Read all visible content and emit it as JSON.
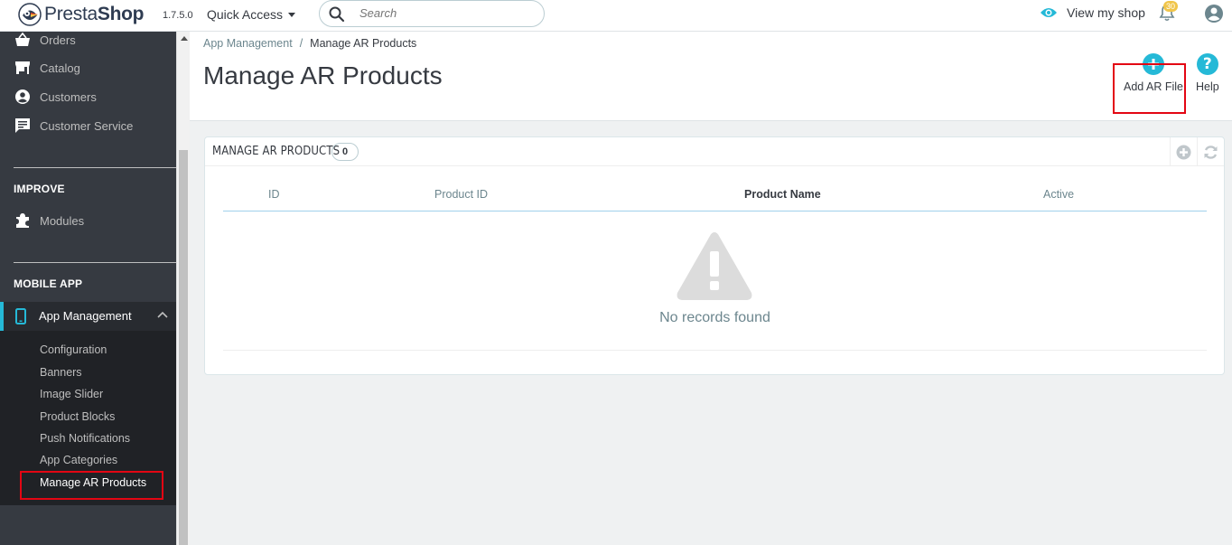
{
  "header": {
    "logo_text_prefix": "Presta",
    "logo_text_suffix": "Shop",
    "version": "1.7.5.0",
    "quick_access": "Quick Access",
    "search_placeholder": "Search",
    "view_my_shop": "View my shop",
    "notification_count": "30"
  },
  "sidebar": {
    "items": [
      {
        "label": "Orders",
        "icon": "basket-icon"
      },
      {
        "label": "Catalog",
        "icon": "store-icon"
      },
      {
        "label": "Customers",
        "icon": "account-circle-icon"
      },
      {
        "label": "Customer Service",
        "icon": "chat-icon"
      }
    ],
    "improve_title": "IMPROVE",
    "modules_label": "Modules",
    "mobile_app_title": "MOBILE APP",
    "app_management_label": "App Management",
    "sub_items": [
      "Configuration",
      "Banners",
      "Image Slider",
      "Product Blocks",
      "Push Notifications",
      "App Categories",
      "Manage AR Products"
    ]
  },
  "page": {
    "breadcrumb_parent": "App Management",
    "breadcrumb_separator": "/",
    "breadcrumb_current": "Manage AR Products",
    "title": "Manage AR Products",
    "add_button_label": "Add AR File",
    "help_button_label": "Help"
  },
  "panel": {
    "title": "MANAGE AR PRODUCTS",
    "count": "0",
    "columns": [
      "ID",
      "Product ID",
      "Product Name",
      "Active"
    ],
    "empty_text": "No records found"
  },
  "colors": {
    "accent": "#25b9d7",
    "sidebar_bg": "#363a41",
    "highlight": "#e30613"
  }
}
